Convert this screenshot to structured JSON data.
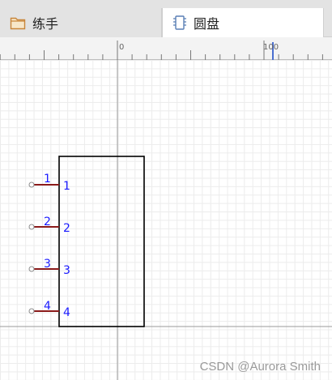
{
  "tabs": [
    {
      "label": "练手",
      "icon": "folder-icon"
    },
    {
      "label": "圆盘",
      "icon": "chip-icon"
    }
  ],
  "ruler": {
    "label_zero": "0",
    "label_hundred": "100"
  },
  "component": {
    "pins": [
      {
        "number": "1",
        "name": "1"
      },
      {
        "number": "2",
        "name": "2"
      },
      {
        "number": "3",
        "name": "3"
      },
      {
        "number": "4",
        "name": "4"
      }
    ]
  },
  "colors": {
    "pin_line": "#8b1a1a",
    "pin_text": "#1a1aff",
    "body_outline": "#000000"
  },
  "watermark": "CSDN @Aurora Smith"
}
